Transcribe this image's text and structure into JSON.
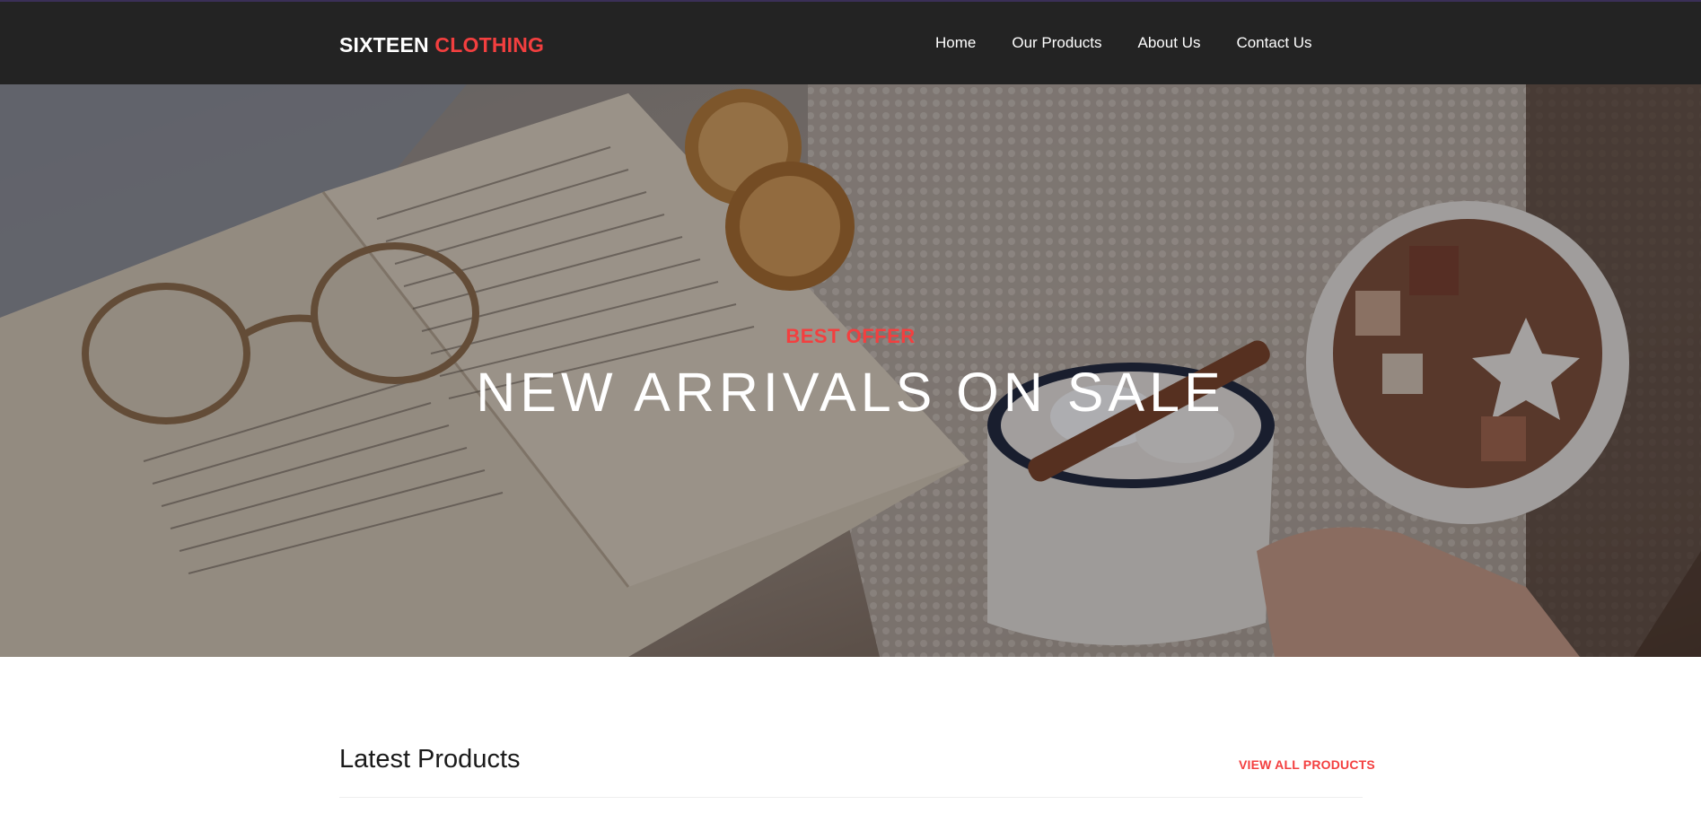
{
  "brand": {
    "part1": "SIXTEEN",
    "part2": "CLOTHING",
    "accent_color": "#f33f3f"
  },
  "nav": {
    "items": [
      "Home",
      "Our Products",
      "About Us",
      "Contact Us"
    ]
  },
  "hero": {
    "kicker": "BEST OFFER",
    "headline": "NEW ARRIVALS ON SALE"
  },
  "products_section": {
    "title": "Latest Products",
    "view_all_label": "VIEW ALL PRODUCTS"
  },
  "colors": {
    "navbar": "#232323",
    "accent": "#f33f3f"
  }
}
